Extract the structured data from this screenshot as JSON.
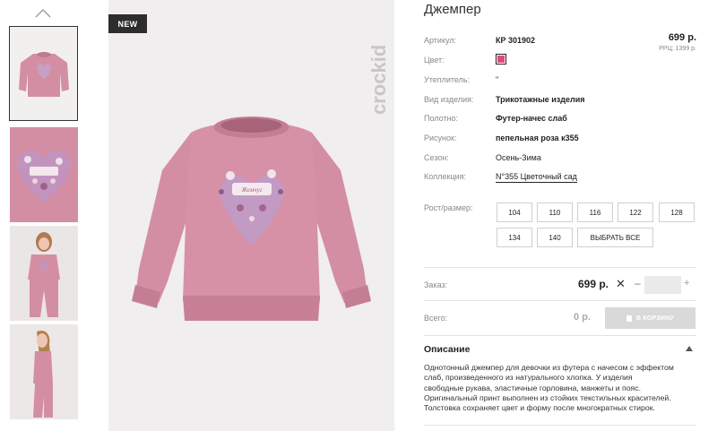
{
  "badge": "NEW",
  "brand": "crockid",
  "product": {
    "title": "Джемпер",
    "price": "699 р.",
    "rrp": "РРЦ: 1399 р.",
    "color_hex": "#e0497f",
    "attributes": [
      {
        "label": "Артикул:",
        "value": "КР 301902",
        "style": "bold"
      },
      {
        "label": "Цвет:",
        "value": "",
        "style": "swatch"
      },
      {
        "label": "Утеплитель:",
        "value": "\"",
        "style": "plain"
      },
      {
        "label": "Вид изделия:",
        "value": "Трикотажные изделия",
        "style": "bold"
      },
      {
        "label": "Полотно:",
        "value": "Футер-начес слаб",
        "style": "bold"
      },
      {
        "label": "Рисунок:",
        "value": "пепельная роза к355",
        "style": "bold"
      },
      {
        "label": "Сезон:",
        "value": "Осень-Зима",
        "style": "plain"
      },
      {
        "label": "Коллекция:",
        "value": "N°355 Цветочный сад",
        "style": "link"
      }
    ]
  },
  "sizes": {
    "label": "Рост/размер:",
    "options": [
      "104",
      "110",
      "116",
      "122",
      "128",
      "134",
      "140"
    ],
    "select_all": "ВЫБРАТЬ ВСЕ"
  },
  "order": {
    "label": "Заказ:",
    "price": "699 р.",
    "times": "✕",
    "minus": "–",
    "plus": "+",
    "quantity": ""
  },
  "total": {
    "label": "Всего:",
    "value": "0 р.",
    "cart_button": "В КОРЗИНУ"
  },
  "description": {
    "title": "Описание",
    "lines": [
      "Однотонный джемпер для девочки из футера с начесом с эффектом",
      "слаб, произведенного из натурального хлопка. У изделия",
      "свободные рукава, эластичные горловина, манжеты и пояс.",
      "Оригинальный принт выполнен из стойких текстильных красителей.",
      "Толстовка сохраняет цвет и форму после многократных стирок."
    ]
  }
}
